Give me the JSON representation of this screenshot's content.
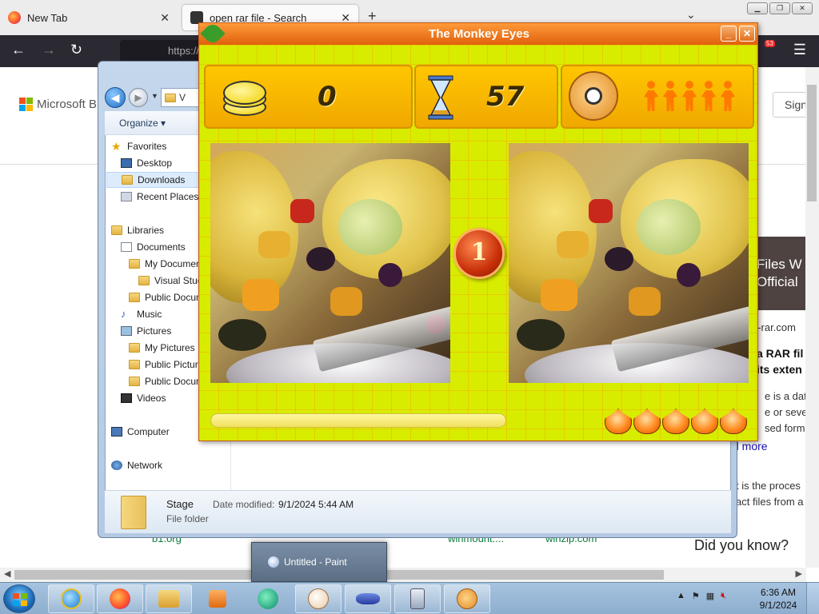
{
  "firefox": {
    "tabs": [
      {
        "label": "New Tab"
      },
      {
        "label": "open rar file - Search"
      }
    ],
    "url_text": "https://",
    "notification_count": "53"
  },
  "bing": {
    "logo_text": "Microsoft Bi",
    "sign_in": "Sign",
    "card_line1": "Files W",
    "card_line2": "Official",
    "site": "n-rar.com",
    "heading1": "a RAR fil",
    "heading2": "its exten",
    "snippet1": "e is a data",
    "snippet2": "e or severa",
    "snippet3": "sed form -",
    "read_more": "d more",
    "snippet4": "t is the proces",
    "snippet5": "act files from a",
    "did_you_know": "Did you know?",
    "bottom_links": [
      "b1.org",
      "winmount....",
      "winzip.com"
    ]
  },
  "explorer": {
    "address": "V",
    "toolbar": {
      "organize": "Organize"
    },
    "nav": [
      {
        "label": "Favorites",
        "icon": "star-icon"
      },
      {
        "label": "Desktop",
        "icon": "desktop-icon"
      },
      {
        "label": "Downloads",
        "icon": "downloads-icon",
        "selected": true
      },
      {
        "label": "Recent Places",
        "icon": "recent-icon"
      },
      {
        "label": "Libraries",
        "icon": "libraries-icon"
      },
      {
        "label": "Documents",
        "icon": "documents-icon"
      },
      {
        "label": "My Documents",
        "icon": "folder-icon"
      },
      {
        "label": "Visual Studio",
        "icon": "folder-icon"
      },
      {
        "label": "Public Documents",
        "icon": "folder-icon"
      },
      {
        "label": "Music",
        "icon": "music-icon"
      },
      {
        "label": "Pictures",
        "icon": "pictures-icon"
      },
      {
        "label": "My Pictures",
        "icon": "folder-icon"
      },
      {
        "label": "Public Pictures",
        "icon": "folder-icon"
      },
      {
        "label": "Public Documents",
        "icon": "folder-icon"
      },
      {
        "label": "Videos",
        "icon": "videos-icon"
      },
      {
        "label": "Computer",
        "icon": "computer-icon"
      },
      {
        "label": "Network",
        "icon": "network-icon"
      }
    ],
    "details": {
      "name": "Stage",
      "type": "File folder",
      "modified_label": "Date modified:",
      "modified_value": "9/1/2024 5:44 AM"
    }
  },
  "game": {
    "title": "The Monkey Eyes",
    "coins": "0",
    "time": "57",
    "lives": 5,
    "difference_number": "1",
    "hints": 5,
    "progress": 0.0
  },
  "taskbar": {
    "popup_label": "Untitled - Paint",
    "clock_time": "6:36 AM",
    "clock_date": "9/1/2024",
    "apps": [
      "internet-explorer-icon",
      "firefox-icon",
      "explorer-folder-icon",
      "media-player-icon",
      "app-icon",
      "paint-icon",
      "infinity-icon",
      "calculator-icon",
      "monkey-eyes-icon"
    ]
  }
}
